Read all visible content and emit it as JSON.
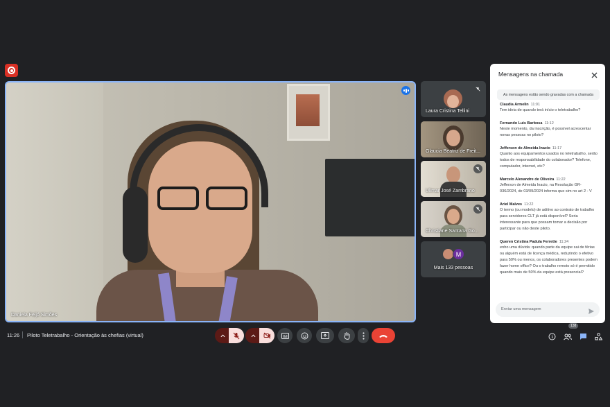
{
  "meeting": {
    "time": "11:26",
    "title": "Piloto Teletrabalho - Orientação às chefias (virtual)"
  },
  "main_speaker": {
    "name": "Daniela Feijó Simões"
  },
  "participants": [
    {
      "name": "Laura Cristina Tellini"
    },
    {
      "name": "Glaucia Beatriz de Freit..."
    },
    {
      "name": "Ulimar José Zambrano"
    },
    {
      "name": "Christiane Santana Go..."
    }
  ],
  "more_people": {
    "label": "Mais 133 pessoas",
    "avatar_letter": "M"
  },
  "people_count": "138",
  "chat": {
    "title": "Mensagens na chamada",
    "notice": "As mensagens estão sendo gravadas com a chamada",
    "input_placeholder": "Enviar uma mensagem",
    "messages": [
      {
        "author": "Claudia Armelin",
        "time": "11:01",
        "text": "Tem ideia de quando terá início o teletrabalho?"
      },
      {
        "author": "Fernando Luis Barbosa",
        "time": "11:12",
        "text": "Neste momento, da inscrição, é possível acrescentar novas pessoas no piloto?"
      },
      {
        "author": "Jefferson de Almeida Inacio",
        "time": "11:17",
        "text": "Quanto aos equipamentos usados no teletrabalho, serão todos de responsabilidade do colaborador? Telefone, computador, internet, etc?"
      },
      {
        "author": "Marcelo Alexandre de Oliveira",
        "time": "11:22",
        "text": "Jefferson de Almeida Inacio, na Resolução GR-036/2024, de 03/09/2024 informa que sim no art 2 - V"
      },
      {
        "author": "Ariel Malves",
        "time": "11:22",
        "text": "O termo (ou modelo) de aditivo ao contrato de trabalho para servidores CLT já está disponível? Seria interessante para que possam tomar a decisão por participar ou não deste piloto."
      },
      {
        "author": "Queren Cristina Padula Ferrette",
        "time": "11:24",
        "text": "enho uma dúvida: quando parte da equipe sai de férias ou alguém está de licença médica, reduzindo o efetivo para 50% ou menos, os colaboradores presentes podem fazer home office? Ou o trabalho remoto só é permitido quando mais de 50% da equipe está presencial?"
      }
    ]
  },
  "colors": {
    "accent": "#8ab4f8",
    "end_call": "#ea4335",
    "record": "#d93025"
  }
}
